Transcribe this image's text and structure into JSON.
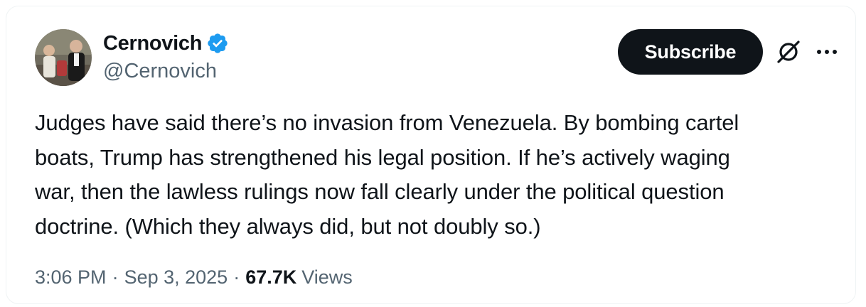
{
  "author": {
    "display_name": "Cernovich",
    "handle": "@Cernovich",
    "verified": true,
    "verified_color": "#1d9bf0"
  },
  "actions": {
    "subscribe_label": "Subscribe",
    "grok_icon": "grok-icon",
    "more_icon": "more-dots-icon"
  },
  "tweet": {
    "text": "Judges have said there’s no invasion from Venezuela. By bombing cartel\nboats, Trump has strengthened his legal position. If he’s actively waging\nwar, then the lawless rulings now fall clearly under the political question\ndoctrine. (Which they always did, but not doubly so.)"
  },
  "meta": {
    "time": "3:06 PM",
    "separator": "·",
    "date": "Sep 3, 2025",
    "views_count": "67.7K",
    "views_label": "Views"
  },
  "colors": {
    "text_primary": "#0f1419",
    "text_secondary": "#536471",
    "button_bg": "#0f1419",
    "border": "#eff3f4"
  }
}
